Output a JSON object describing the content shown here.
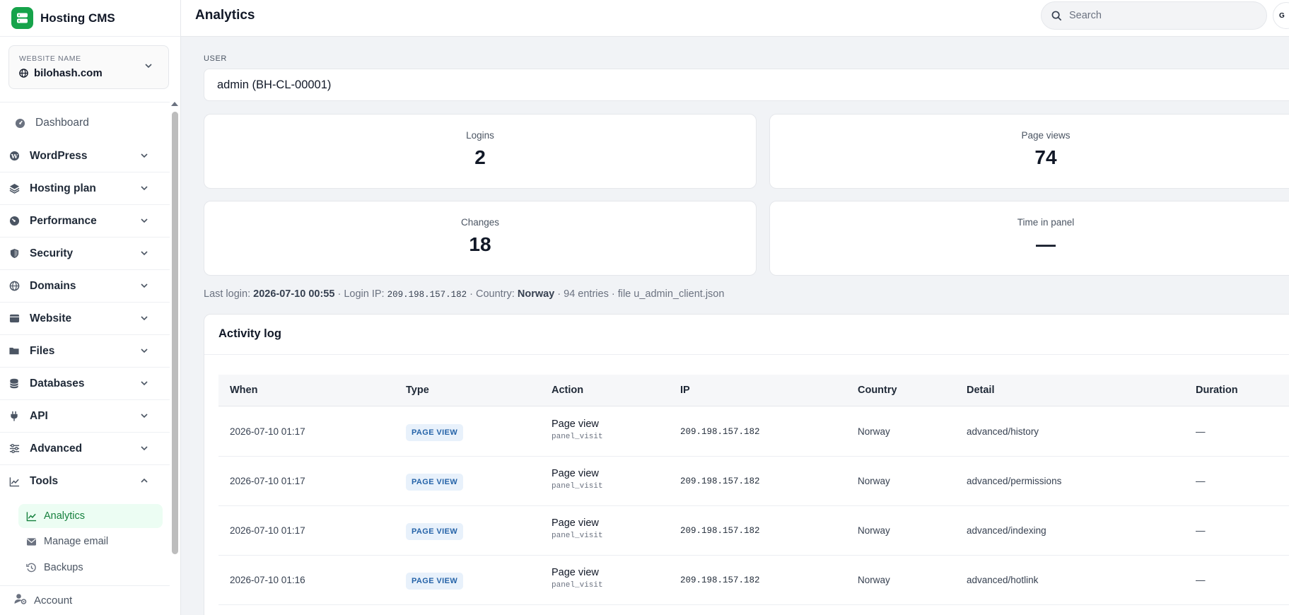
{
  "brand": {
    "name": "Hosting CMS"
  },
  "website": {
    "label": "WEBSITE NAME",
    "value": "bilohash.com"
  },
  "sidebar": {
    "dashboard": "Dashboard",
    "items": [
      {
        "label": "WordPress",
        "icon": "wordpress-icon"
      },
      {
        "label": "Hosting plan",
        "icon": "layers-icon"
      },
      {
        "label": "Performance",
        "icon": "gauge-icon"
      },
      {
        "label": "Security",
        "icon": "shield-icon"
      },
      {
        "label": "Domains",
        "icon": "globe-icon"
      },
      {
        "label": "Website",
        "icon": "browser-icon"
      },
      {
        "label": "Files",
        "icon": "folder-icon"
      },
      {
        "label": "Databases",
        "icon": "database-icon"
      },
      {
        "label": "API",
        "icon": "plug-icon"
      },
      {
        "label": "Advanced",
        "icon": "sliders-icon"
      },
      {
        "label": "Tools",
        "icon": "chart-line-icon",
        "expanded": true
      }
    ],
    "tools_sub": [
      {
        "label": "Analytics",
        "icon": "chart-line-icon",
        "active": true
      },
      {
        "label": "Manage email",
        "icon": "mail-icon"
      },
      {
        "label": "Backups",
        "icon": "history-icon"
      }
    ],
    "account": "Account"
  },
  "header": {
    "title": "Analytics",
    "search_placeholder": "Search",
    "avatar_initial": "G"
  },
  "user": {
    "label": "USER",
    "value": "admin (BH-CL-00001)"
  },
  "stats": {
    "logins": {
      "label": "Logins",
      "value": "2"
    },
    "page_views": {
      "label": "Page views",
      "value": "74"
    },
    "changes": {
      "label": "Changes",
      "value": "18"
    },
    "time_in_panel": {
      "label": "Time in panel",
      "value": "—"
    }
  },
  "meta": {
    "last_login_label": "Last login:",
    "last_login": "2026-07-10 00:55",
    "login_ip_label": "· Login IP:",
    "login_ip": "209.198.157.182",
    "country_label": "· Country:",
    "country": "Norway",
    "tail": "· 94 entries · file u_admin_client.json"
  },
  "activity": {
    "title": "Activity log",
    "columns": [
      "When",
      "Type",
      "Action",
      "IP",
      "Country",
      "Detail",
      "Duration"
    ],
    "rows": [
      {
        "when": "2026-07-10 01:17",
        "type": "PAGE VIEW",
        "action": "Page view",
        "action_code": "panel_visit",
        "ip": "209.198.157.182",
        "country": "Norway",
        "detail": "advanced/history",
        "duration": "—"
      },
      {
        "when": "2026-07-10 01:17",
        "type": "PAGE VIEW",
        "action": "Page view",
        "action_code": "panel_visit",
        "ip": "209.198.157.182",
        "country": "Norway",
        "detail": "advanced/permissions",
        "duration": "—"
      },
      {
        "when": "2026-07-10 01:17",
        "type": "PAGE VIEW",
        "action": "Page view",
        "action_code": "panel_visit",
        "ip": "209.198.157.182",
        "country": "Norway",
        "detail": "advanced/indexing",
        "duration": "—"
      },
      {
        "when": "2026-07-10 01:16",
        "type": "PAGE VIEW",
        "action": "Page view",
        "action_code": "panel_visit",
        "ip": "209.198.157.182",
        "country": "Norway",
        "detail": "advanced/hotlink",
        "duration": "—"
      }
    ]
  },
  "colors": {
    "accent": "#16a34a",
    "badge_bg": "#e8f1fb",
    "badge_text": "#2563a8"
  }
}
